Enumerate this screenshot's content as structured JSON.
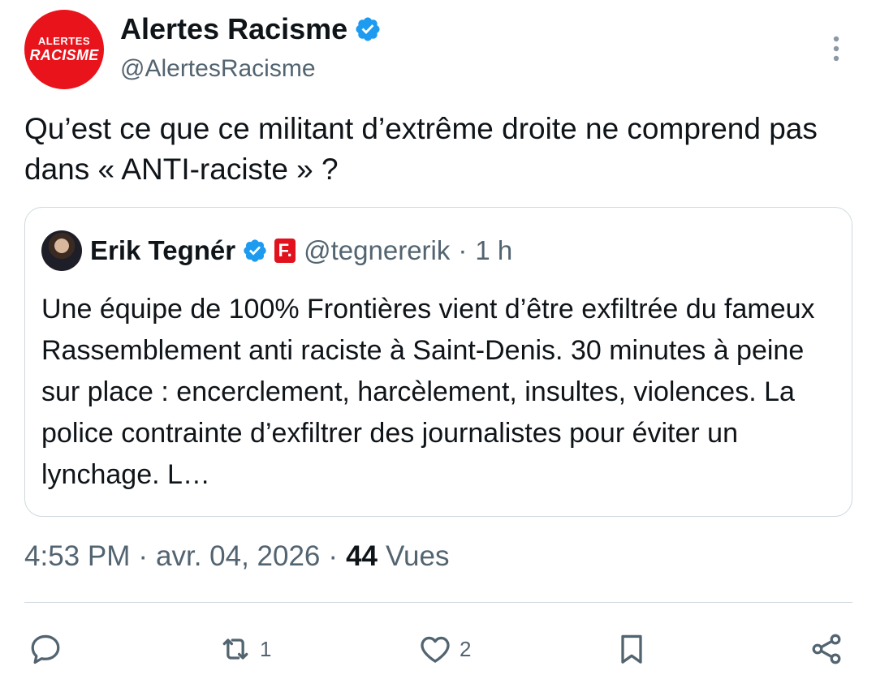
{
  "author": {
    "avatar_line1": "ALERTES",
    "avatar_line2": "RACISME",
    "display_name": "Alertes Racisme",
    "handle": "@AlertesRacisme"
  },
  "tweet": {
    "text": "Qu’est ce que ce militant d’extrême droite ne comprend pas dans « ANTI-raciste » ?"
  },
  "quoted_tweet": {
    "display_name": "Erik Tegnér",
    "badge_letter": "F.",
    "handle": "@tegnererik",
    "separator": "·",
    "time": "1 h",
    "text": "Une équipe de 100% Frontières vient d’être exfiltrée du fameux Rassemblement anti raciste à Saint-Denis. 30 minutes à peine sur place : encerclement, harcèlement, insultes, violences. La police contrainte d’exfiltrer des journalistes pour éviter un lynchage. L…"
  },
  "meta": {
    "time": "4:53 PM",
    "sep1": "·",
    "date": "avr. 04, 2026",
    "sep2": "·",
    "views_count": "44",
    "views_label": "Vues"
  },
  "actions": {
    "reply_icon": "reply-icon",
    "retweet_icon": "retweet-icon",
    "retweet_count": "1",
    "like_icon": "heart-icon",
    "like_count": "2",
    "bookmark_icon": "bookmark-icon",
    "share_icon": "share-icon"
  },
  "colors": {
    "verified": "#1d9bf0",
    "brand_red": "#e8131b",
    "secondary_text": "#536471"
  }
}
